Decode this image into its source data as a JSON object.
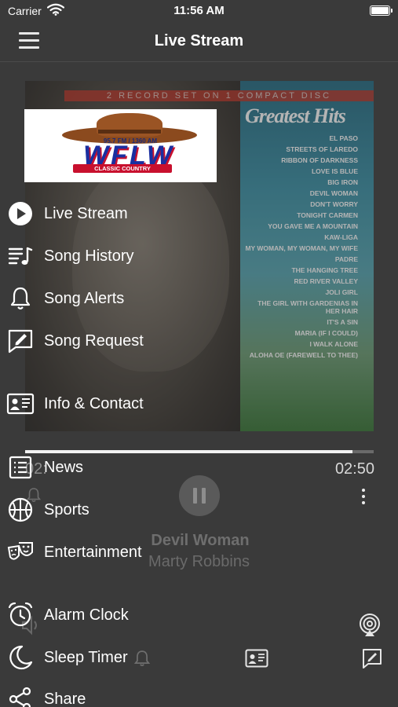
{
  "status_bar": {
    "carrier": "Carrier",
    "time": "11:56 AM"
  },
  "nav": {
    "title": "Live Stream",
    "menu_icon": "hamburger-menu-icon"
  },
  "album_art": {
    "banner_text": "2 RECORD SET ON 1 COMPACT DISC",
    "title": "Greatest Hits",
    "tracks": [
      "EL PASO",
      "STREETS OF LAREDO",
      "RIBBON OF DARKNESS",
      "LOVE IS BLUE",
      "BIG IRON",
      "DEVIL WOMAN",
      "DON'T WORRY",
      "TONIGHT CARMEN",
      "YOU GAVE ME A MOUNTAIN",
      "KAW-LIGA",
      "MY WOMAN, MY WOMAN, MY WIFE",
      "PADRE",
      "THE HANGING TREE",
      "RED RIVER VALLEY",
      "JOLI GIRL",
      "THE GIRL WITH GARDENIAS IN HER HAIR",
      "IT'S A SIN",
      "MARIA (IF I COULD)",
      "I WALK ALONE",
      "ALOHA OE (FAREWELL TO THEE)"
    ]
  },
  "station_logo": {
    "frequency": "95.7 FM / 1360 AM",
    "call_letters": "WFLW",
    "tagline": "CLASSIC COUNTRY"
  },
  "player": {
    "elapsed": "02:",
    "duration": "02:50",
    "progress_fraction": 0.94,
    "song_title": "Devil Woman",
    "artist": "Marty Robbins",
    "state": "playing"
  },
  "menu": {
    "items": [
      {
        "label": "Live Stream",
        "icon": "play-circle-icon"
      },
      {
        "label": "Song History",
        "icon": "music-list-icon"
      },
      {
        "label": "Song Alerts",
        "icon": "bell-icon"
      },
      {
        "label": "Song Request",
        "icon": "edit-message-icon"
      },
      {
        "label": "Info & Contact",
        "icon": "contact-card-icon"
      },
      {
        "label": "News",
        "icon": "news-list-icon"
      },
      {
        "label": "Sports",
        "icon": "basketball-icon"
      },
      {
        "label": "Entertainment",
        "icon": "theater-masks-icon"
      },
      {
        "label": "Alarm Clock",
        "icon": "alarm-clock-icon"
      },
      {
        "label": "Sleep Timer",
        "icon": "moon-icon"
      },
      {
        "label": "Share",
        "icon": "share-icon"
      }
    ]
  },
  "colors": {
    "background": "#3a3a3a",
    "text": "#ffffff",
    "logo_blue": "#1a2fa0",
    "logo_red": "#c8102e"
  }
}
